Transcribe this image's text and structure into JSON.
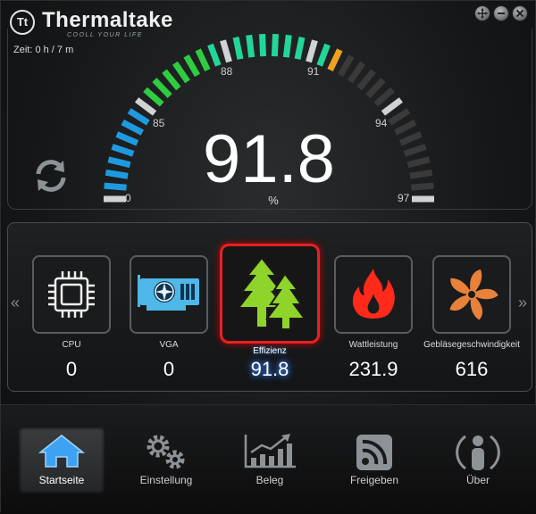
{
  "header": {
    "brand": "Thermaltake",
    "brand_mark": "Tt",
    "tagline": "COOLL YOUR LIFE",
    "window_buttons": [
      "move",
      "minimize",
      "close"
    ]
  },
  "session": {
    "time_label": "Zeit: 0 h / 7 m"
  },
  "gauge": {
    "value": "91.8",
    "value_num": 91.8,
    "unit": "%",
    "tick_labels": [
      "0",
      "85",
      "88",
      "91",
      "94",
      "97"
    ],
    "colors": {
      "blue": "#1e9be0",
      "green": "#2ecc40",
      "teal": "#22d69a",
      "orange": "#f0a020",
      "inactive": "#3a3a3a"
    }
  },
  "sensors": [
    {
      "id": "cpu",
      "label": "CPU",
      "value": "0",
      "icon": "cpu-chip-icon",
      "active": false
    },
    {
      "id": "vga",
      "label": "VGA",
      "value": "0",
      "icon": "graphics-card-icon",
      "active": false
    },
    {
      "id": "effizienz",
      "label": "Effizienz",
      "value": "91.8",
      "icon": "trees-icon",
      "active": true
    },
    {
      "id": "wattleistung",
      "label": "Wattleistung",
      "value": "231.9",
      "icon": "flame-icon",
      "active": false
    },
    {
      "id": "geblase",
      "label": "Gebläsegeschwindigkeit",
      "value": "616",
      "icon": "fan-icon",
      "active": false
    }
  ],
  "nav": [
    {
      "label": "Startseite",
      "icon": "home-icon",
      "active": true
    },
    {
      "label": "Einstellung",
      "icon": "gears-icon",
      "active": false
    },
    {
      "label": "Beleg",
      "icon": "chart-icon",
      "active": false
    },
    {
      "label": "Freigeben",
      "icon": "share-signal-icon",
      "active": false
    },
    {
      "label": "Über",
      "icon": "info-person-icon",
      "active": false
    }
  ]
}
